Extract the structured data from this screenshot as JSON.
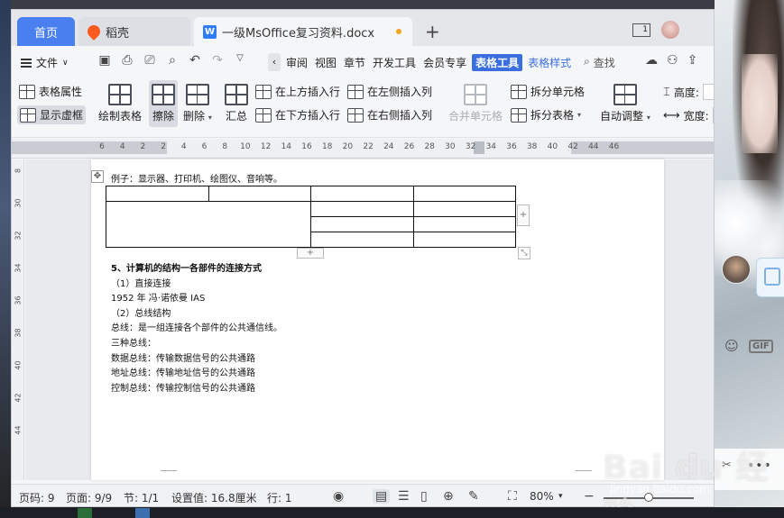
{
  "tabs": {
    "home": "首页",
    "daoke": "稻壳",
    "document": "一级MsOffice复习资料.docx",
    "add": "+"
  },
  "titlebar": {
    "window_count": "1"
  },
  "menu": {
    "file": "文件",
    "items": [
      "审阅",
      "视图",
      "章节",
      "开发工具",
      "会员专享",
      "表格工具",
      "表格样式"
    ],
    "active_item": "表格工具",
    "search": "查找"
  },
  "ribbon": {
    "table_props": "表格属性",
    "show_gridlines": "显示虚框",
    "draw_table": "绘制表格",
    "erase": "擦除",
    "delete": "删除",
    "sum": "汇总",
    "insert_above": "在上方插入行",
    "insert_below": "在下方插入行",
    "insert_left": "在左侧插入列",
    "insert_right": "在右侧插入列",
    "merge_cells": "合并单元格",
    "split_cells": "拆分单元格",
    "split_table": "拆分表格",
    "auto_fit": "自动调整",
    "height": "高度:",
    "width": "宽度:"
  },
  "ruler": {
    "ticks": [
      "6",
      "4",
      "2",
      "2",
      "4",
      "6",
      "8",
      "10",
      "12",
      "14",
      "16",
      "18",
      "20",
      "22",
      "24",
      "26",
      "28",
      "30",
      "32",
      "34",
      "36",
      "38",
      "40",
      "42",
      "44",
      "46"
    ],
    "vertical": [
      "8",
      "30",
      "32",
      "34",
      "36",
      "38",
      "40",
      "42",
      "44"
    ]
  },
  "document": {
    "caption": "例子：显示器、打印机、绘图仪、音响等。",
    "heading": "5、计算机的结构一各部件的连接方式",
    "lines": [
      "（1）直接连接",
      "1952 年  冯·诺依曼  IAS",
      "（2）总线结构",
      "总线：是一组连接各个部件的公共通信线。",
      "三种总线：",
      "数据总线：传输数据信号的公共通路",
      "地址总线：传输地址信号的公共通路",
      "控制总线：传输控制信号的公共通路"
    ]
  },
  "status": {
    "page_number": "页码: 9",
    "page_count": "页面: 9/9",
    "section": "节: 1/1",
    "position": "设置值: 16.8厘米",
    "row": "行: 1",
    "zoom": "80%",
    "zoom_value": 0.8
  },
  "watermark": {
    "brand": "Bai du 经验",
    "url": "jingyan.baidu.com"
  },
  "chat": {
    "gif": "GIF",
    "more": "•••"
  }
}
